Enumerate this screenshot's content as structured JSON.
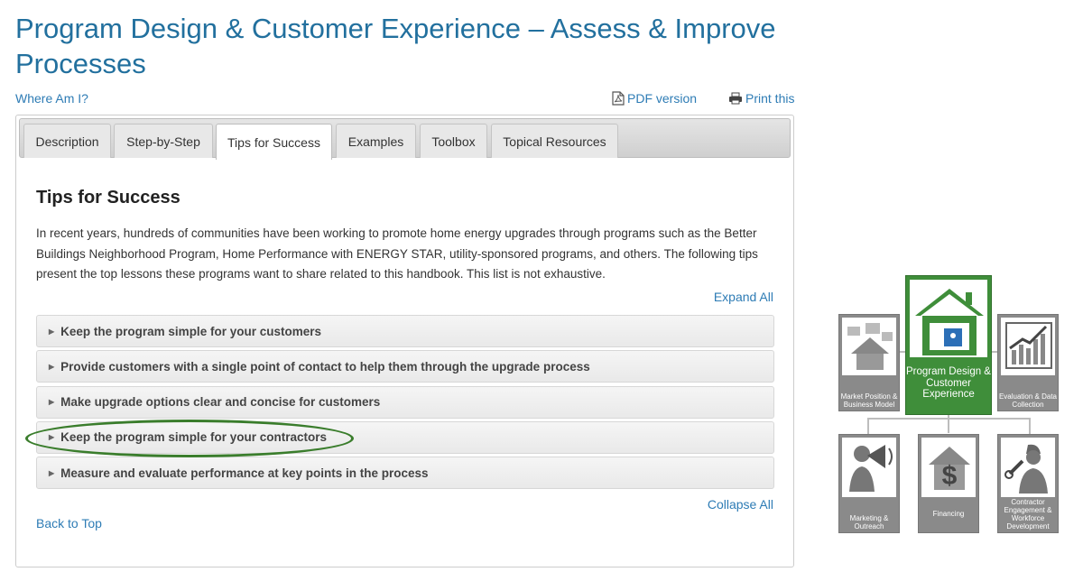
{
  "page": {
    "title": "Program Design & Customer Experience – Assess & Improve Processes",
    "where_am_i": "Where Am I?",
    "pdf_version": "PDF version",
    "print_this": "Print this"
  },
  "tabs": [
    {
      "label": "Description"
    },
    {
      "label": "Step-by-Step"
    },
    {
      "label": "Tips for Success",
      "active": true
    },
    {
      "label": "Examples"
    },
    {
      "label": "Toolbox"
    },
    {
      "label": "Topical Resources"
    }
  ],
  "content": {
    "heading": "Tips for Success",
    "intro": "In recent years, hundreds of communities have been working to promote home energy upgrades through programs such as the Better Buildings Neighborhood Program, Home Performance with ENERGY STAR, utility-sponsored programs, and others. The following tips present the top lessons these programs want to share related to this handbook. This list is not exhaustive.",
    "expand_all": "Expand All",
    "collapse_all": "Collapse All",
    "back_to_top": "Back to Top",
    "tips": [
      {
        "label": "Keep the program simple for your customers"
      },
      {
        "label": "Provide customers with a single point of contact to help them through the upgrade process"
      },
      {
        "label": "Make upgrade options clear and concise for customers"
      },
      {
        "label": "Keep the program simple for your contractors",
        "highlighted": true
      },
      {
        "label": "Measure and evaluate performance at key points in the process"
      }
    ]
  },
  "diagram": {
    "center": "Program Design & Customer Experience",
    "market": "Market Position & Business Model",
    "evaluation": "Evaluation & Data Collection",
    "marketing": "Marketing & Outreach",
    "financing": "Financing",
    "contractor": "Contractor Engagement & Workforce Development"
  },
  "colors": {
    "title": "#22709e",
    "link": "#2e7cb5",
    "highlight": "#3a7d2c",
    "diagram_green": "#3f8e3a",
    "diagram_gray": "#8a8a8a"
  }
}
